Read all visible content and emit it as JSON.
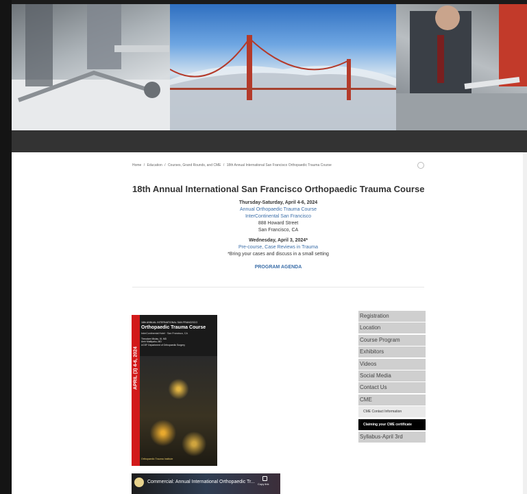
{
  "breadcrumb": {
    "items": [
      "Home",
      "/",
      "Education",
      "/",
      "Courses, Grand Rounds, and CME",
      "/",
      "18th Annual International San Francisco Orthopaedic Trauma Course"
    ]
  },
  "intro": {
    "title": "18th Annual International San Francisco Orthopaedic Trauma Course",
    "date_main": "Thursday-Saturday, April 4-6, 2024",
    "course_link": "Annual Orthopaedic Trauma Course",
    "venue_link": "InterContinental San Francisco",
    "address_street": "888 Howard Street",
    "address_city": "San Francisco, CA",
    "date_precourse": "Wednesday, April 3, 2024*",
    "precourse_link": "Pre-course, Case Reviews in Trauma",
    "precourse_note": "*Bring your cases and discuss in a small setting",
    "agenda_link": "PROGRAM AGENDA"
  },
  "poster": {
    "date_band": "APRIL (3) 4-6, 2024",
    "header_line": "18th ANNUAL INTERNATIONAL SAN FRANCISCO",
    "title": "Orthopaedic Trauma Course",
    "location": "InterContinental Hotel · San Francisco, CA",
    "names": [
      "Theodore Miclau, III, MD",
      "Amir Matityahu, MD",
      "UCSF Department of Orthopaedic Surgery"
    ],
    "footer": "Orthopaedic Trauma Institute"
  },
  "sidebar": {
    "items": [
      "Registration",
      "Location",
      "Course Program",
      "Exhibitors",
      "Videos",
      "Social Media",
      "Contact Us",
      "CME"
    ],
    "sub_items": [
      "CME Contact Information",
      "Claiming your CME certificate"
    ],
    "last_item": "Syllabus-April 3rd"
  },
  "video": {
    "title": "Commercial: Annual International Orthopaedic Tr...",
    "copy_label": "Copy link"
  }
}
